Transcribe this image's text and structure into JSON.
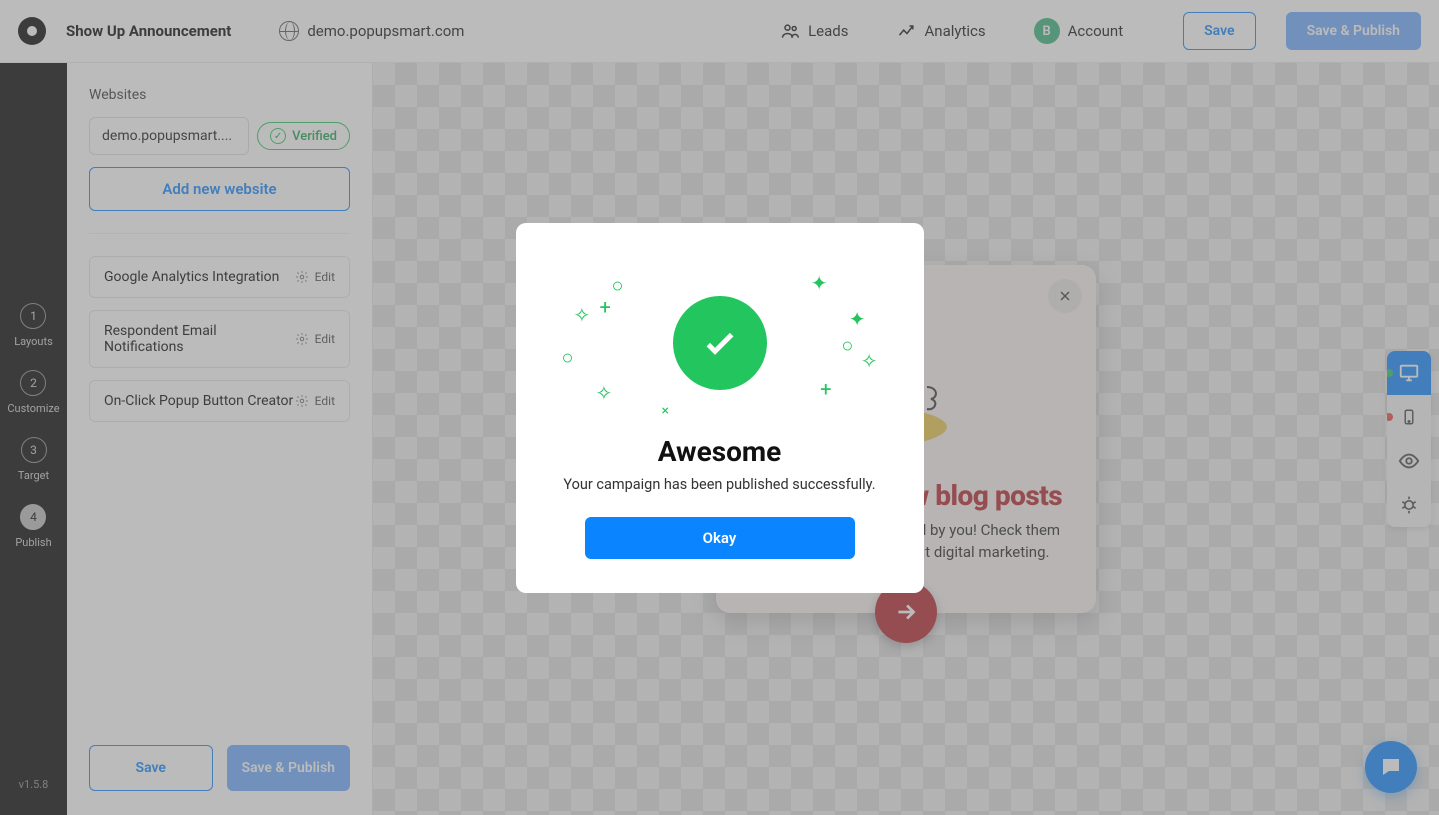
{
  "topbar": {
    "campaign_name": "Show Up Announcement",
    "domain": "demo.popupsmart.com",
    "leads_label": "Leads",
    "analytics_label": "Analytics",
    "account_label": "Account",
    "account_initial": "B",
    "save_label": "Save",
    "publish_label": "Save & Publish"
  },
  "vrail": {
    "steps": [
      {
        "num": "1",
        "label": "Layouts"
      },
      {
        "num": "2",
        "label": "Customize"
      },
      {
        "num": "3",
        "label": "Target"
      },
      {
        "num": "4",
        "label": "Publish"
      }
    ],
    "version": "v1.5.8"
  },
  "sidepanel": {
    "websites_label": "Websites",
    "site_value": "demo.popupsmart....",
    "verified_label": "Verified",
    "add_website_label": "Add new website",
    "settings": [
      {
        "label": "Google Analytics Integration",
        "edit": "Edit"
      },
      {
        "label": "Respondent Email Notifications",
        "edit": "Edit"
      },
      {
        "label": "On-Click Popup Button Creator",
        "edit": "Edit"
      }
    ],
    "footer_save": "Save",
    "footer_publish": "Save & Publish"
  },
  "popup": {
    "title": "Check out new blog posts",
    "body_line1": "Latest contents requested by you! Check them",
    "body_line2": "out and learn more about digital marketing."
  },
  "modal": {
    "title": "Awesome",
    "body": "Your campaign has been published successfully.",
    "button": "Okay"
  }
}
